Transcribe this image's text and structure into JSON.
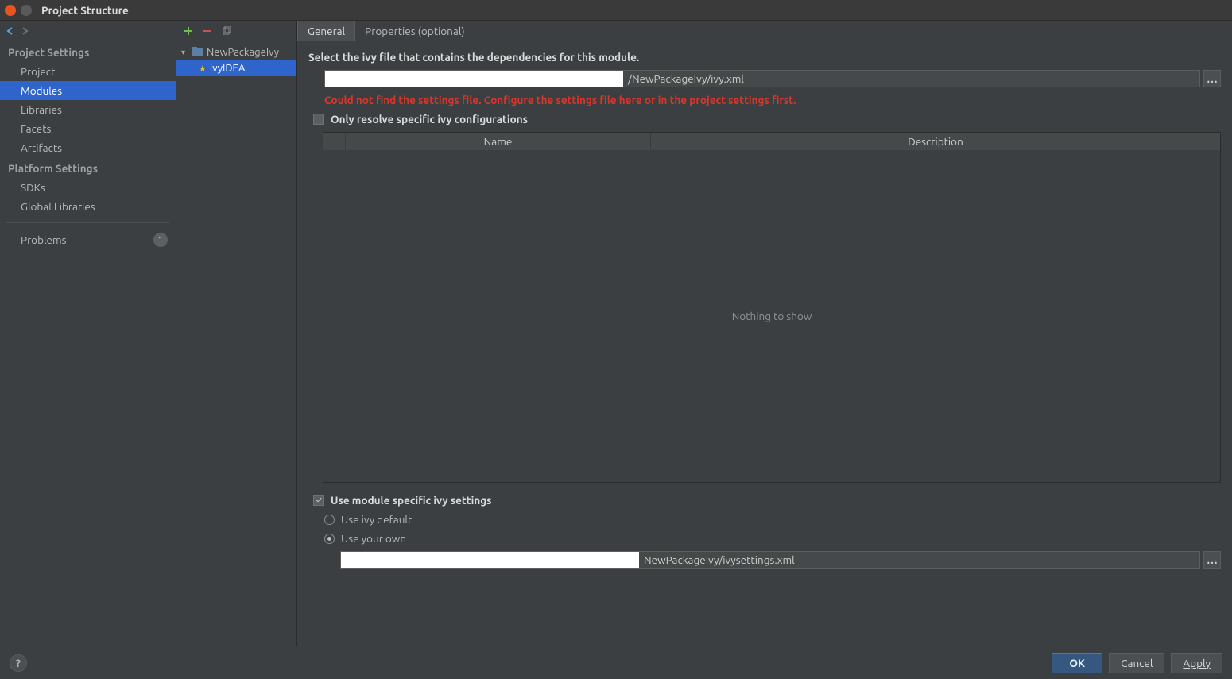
{
  "titlebar": {
    "title": "Project Structure"
  },
  "sidebar": {
    "headings": {
      "project_settings": "Project Settings",
      "platform_settings": "Platform Settings"
    },
    "items": {
      "project": "Project",
      "modules": "Modules",
      "libraries": "Libraries",
      "facets": "Facets",
      "artifacts": "Artifacts",
      "sdks": "SDKs",
      "global_libraries": "Global Libraries",
      "problems": "Problems"
    },
    "problems_count": "1"
  },
  "tree": {
    "root": "NewPackageIvy",
    "child": "IvyIDEA"
  },
  "tabs": {
    "general": "General",
    "properties": "Properties (optional)"
  },
  "panel": {
    "instruction": "Select the ivy file that contains the dependencies for this module.",
    "ivy_path_tail": "/NewPackageIvy/ivy.xml",
    "error": "Could not find the settings file. Configure the settings file here or in the project settings first.",
    "only_resolve_label": "Only resolve specific ivy configurations",
    "table": {
      "col_name": "Name",
      "col_description": "Description",
      "empty": "Nothing to show"
    },
    "use_module_specific_label": "Use module specific ivy settings",
    "radio_default": "Use ivy default",
    "radio_own": "Use your own",
    "settings_path_tail": "NewPackageIvy/ivysettings.xml"
  },
  "footer": {
    "ok": "OK",
    "cancel": "Cancel",
    "apply": "Apply"
  }
}
